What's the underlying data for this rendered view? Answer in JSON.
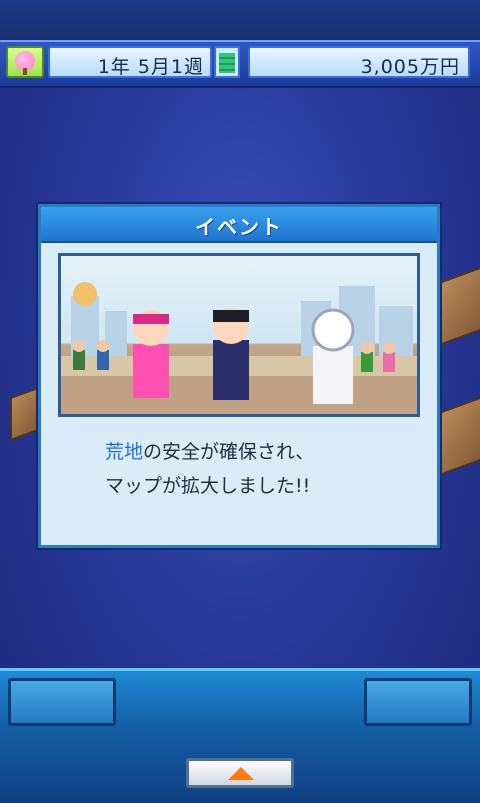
{
  "status": {
    "date": "1年 5月1週",
    "money": "3,005万円",
    "gauge_level": 0.7
  },
  "dialog": {
    "title": "イベント",
    "message_highlight": "荒地",
    "message_line1_rest": "の安全が確保され、",
    "message_line2": "マップが拡大しました!!"
  },
  "icons": {
    "status_left": "pink-tree-icon",
    "bottom": "up-arrow-icon"
  },
  "colors": {
    "accent": "#2e78c8",
    "highlight_text": "#1b6fd6",
    "arrow": "#ff7a10"
  }
}
